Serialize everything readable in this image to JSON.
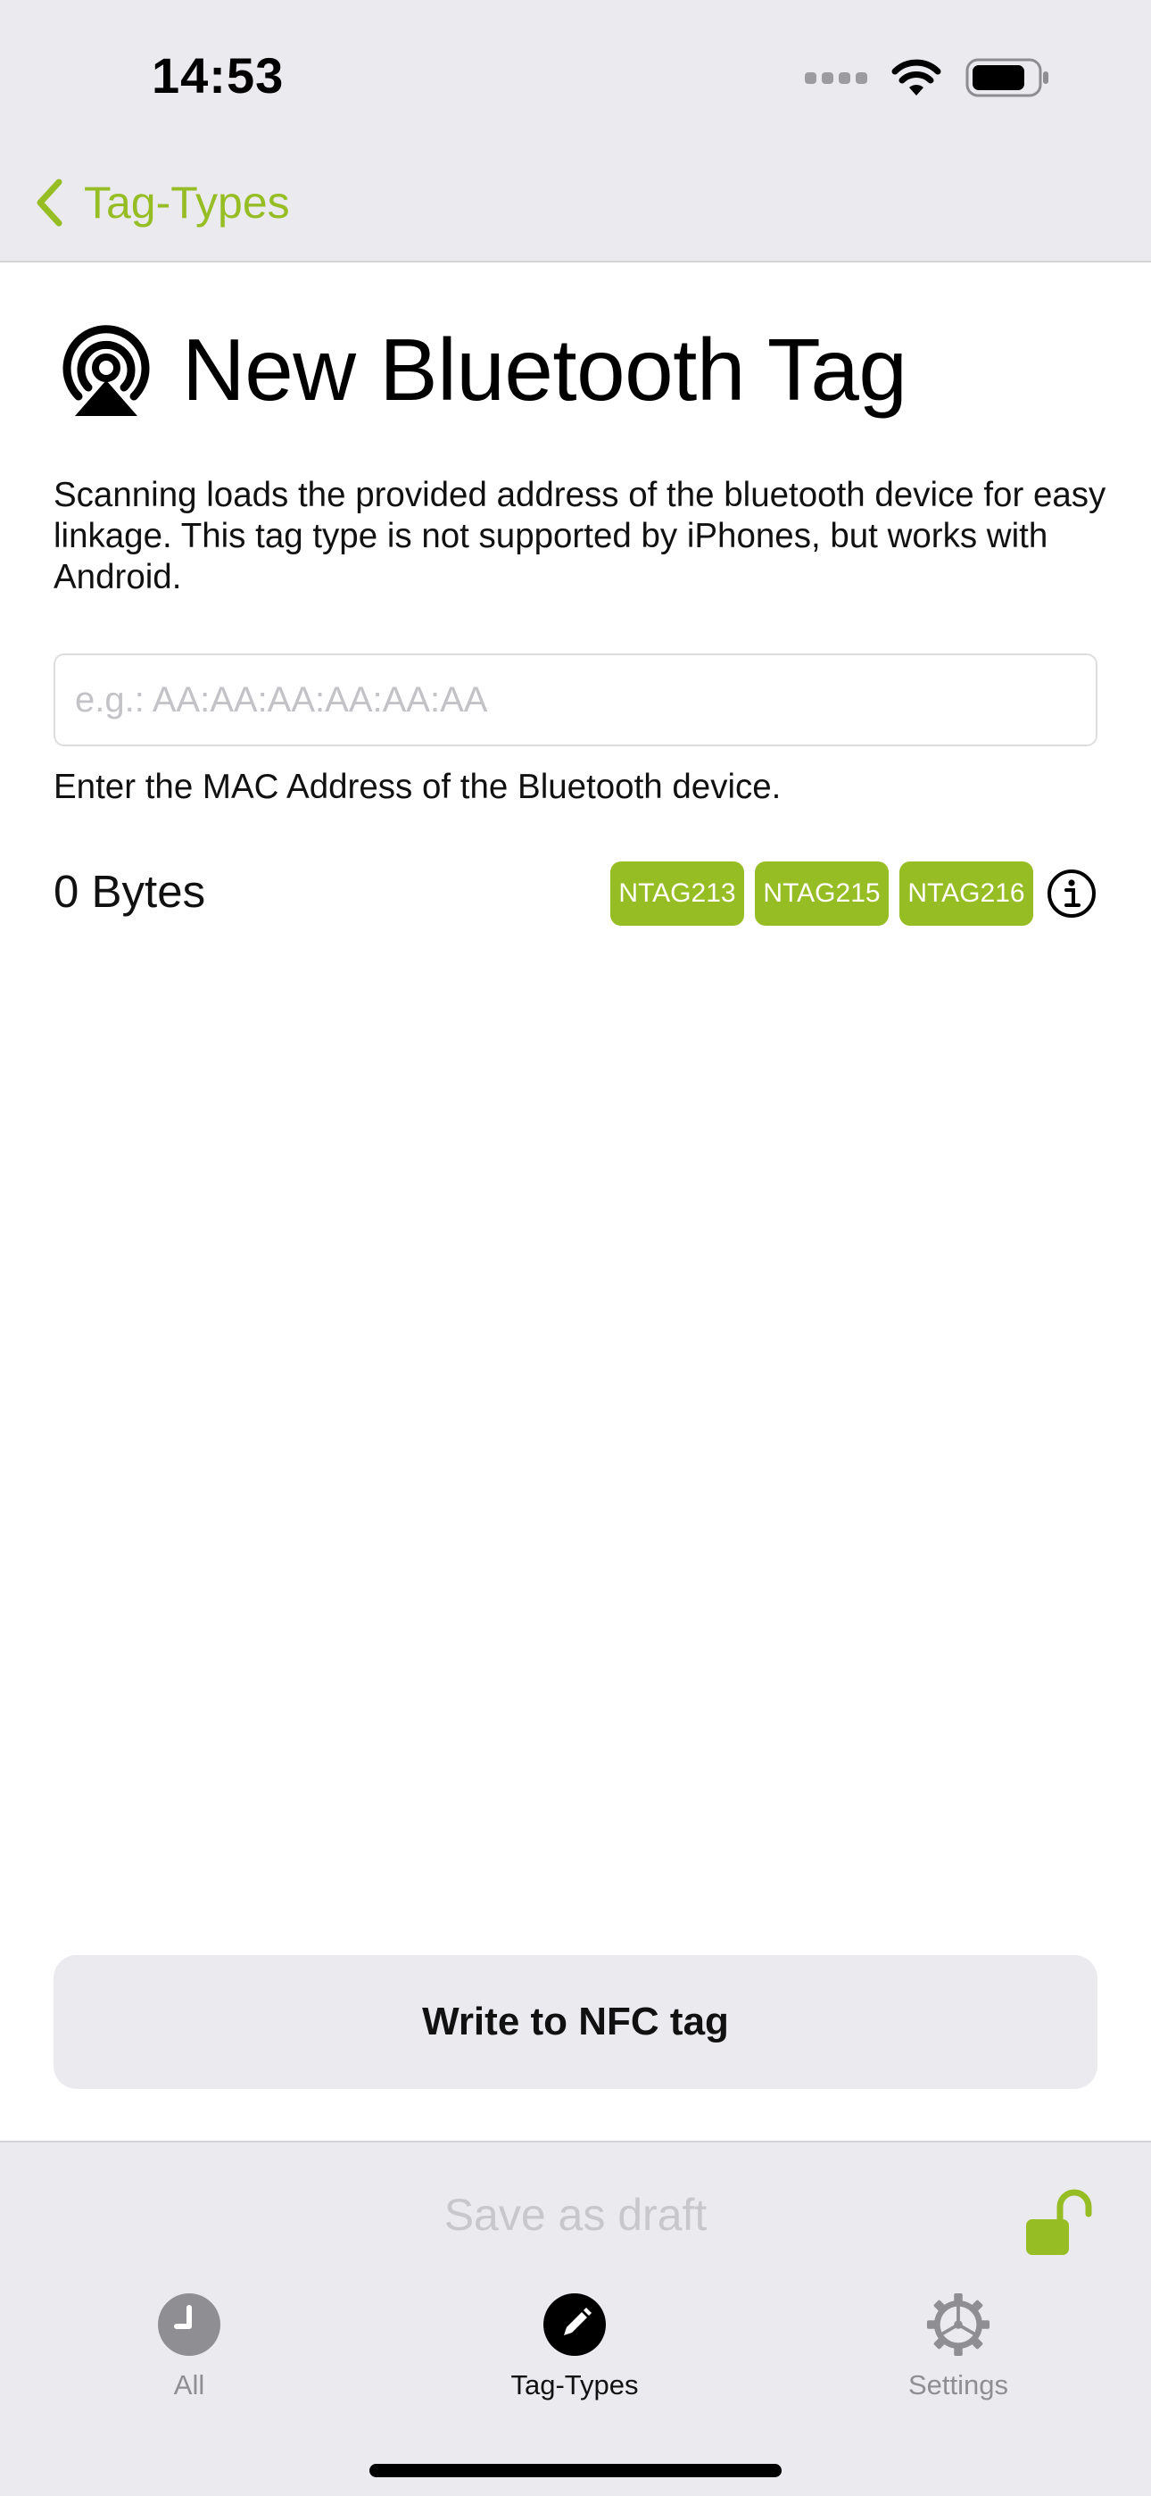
{
  "status_bar": {
    "time": "14:53",
    "icons": [
      "cellular-signal-icon",
      "wifi-icon",
      "battery-icon"
    ]
  },
  "nav": {
    "back_label": "Tag-Types",
    "back_icon": "chevron-left-icon"
  },
  "page": {
    "icon": "bluetooth-broadcast-icon",
    "title": "New Bluetooth Tag",
    "description": "Scanning loads the provided address of the bluetooth device for easy linkage. This tag type is not supported by iPhones, but works with Android.",
    "mac_input": {
      "value": "",
      "placeholder": "e.g.: AA:AA:AA:AA:AA:AA"
    },
    "mac_hint": "Enter the MAC Address of the Bluetooth device.",
    "bytes_label": "0 Bytes",
    "tag_chips": [
      "NTAG213",
      "NTAG215",
      "NTAG216"
    ],
    "info_icon": "info-icon",
    "write_button": "Write to NFC tag"
  },
  "bottom": {
    "save_draft": "Save as draft",
    "lock_icon": "unlocked-padlock-icon",
    "tabs": [
      {
        "label": "All",
        "icon": "clock-icon",
        "active": false
      },
      {
        "label": "Tag-Types",
        "icon": "pencil-icon",
        "active": true
      },
      {
        "label": "Settings",
        "icon": "gear-icon",
        "active": false
      }
    ]
  },
  "colors": {
    "accent": "#97bd25",
    "header_bg": "#ebebef",
    "inactive": "#8e8e93"
  }
}
